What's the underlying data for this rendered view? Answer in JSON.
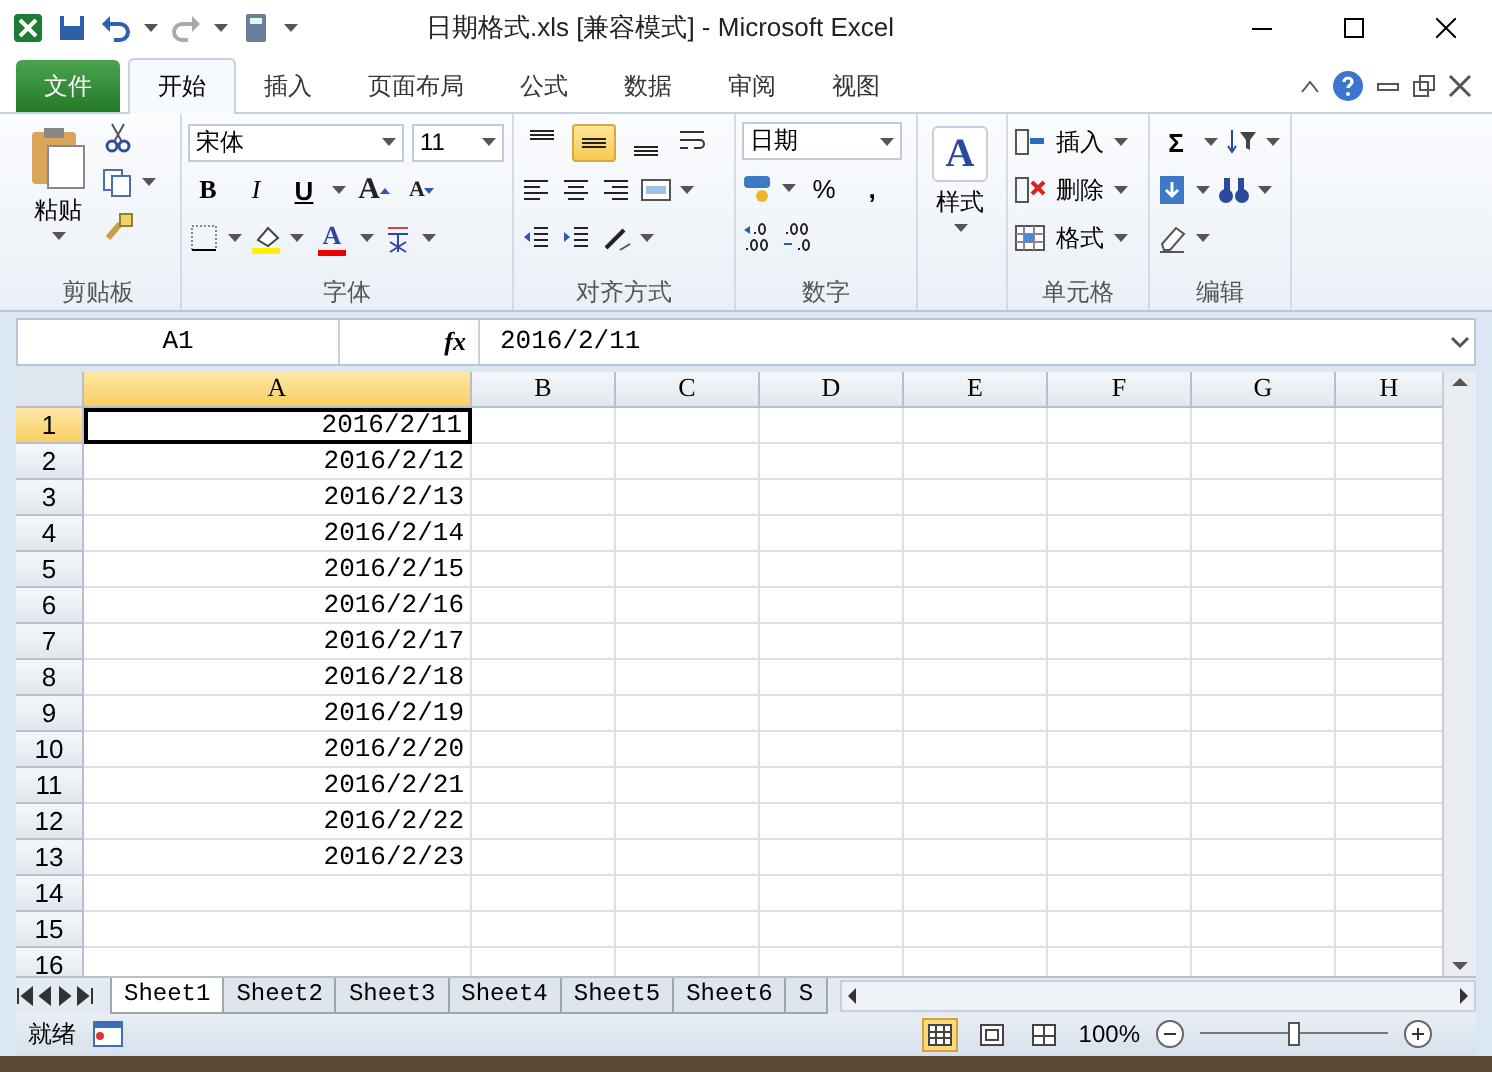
{
  "window": {
    "title": "日期格式.xls  [兼容模式]  -  Microsoft Excel"
  },
  "tabs": [
    {
      "label": "文件",
      "kind": "file",
      "selected": false
    },
    {
      "label": "开始",
      "kind": "tab",
      "selected": true
    },
    {
      "label": "插入",
      "kind": "tab",
      "selected": false
    },
    {
      "label": "页面布局",
      "kind": "tab",
      "selected": false
    },
    {
      "label": "公式",
      "kind": "tab",
      "selected": false
    },
    {
      "label": "数据",
      "kind": "tab",
      "selected": false
    },
    {
      "label": "审阅",
      "kind": "tab",
      "selected": false
    },
    {
      "label": "视图",
      "kind": "tab",
      "selected": false
    }
  ],
  "ribbon": {
    "clipboard": {
      "label": "剪贴板",
      "paste": "粘贴"
    },
    "font": {
      "label": "字体",
      "font_name": "宋体",
      "font_size": "11",
      "bold": "B",
      "italic": "I",
      "underline": "U",
      "grow": "A",
      "shrink": "A",
      "font_color": "A"
    },
    "alignment": {
      "label": "对齐方式",
      "vertical": [
        {
          "kind": "top",
          "selected": false
        },
        {
          "kind": "middle",
          "selected": true
        },
        {
          "kind": "bottom",
          "selected": false
        }
      ]
    },
    "number": {
      "label": "数字",
      "format": "日期",
      "percent": "%",
      "comma": ","
    },
    "styles": {
      "button": "样式",
      "icon_letter": "A"
    },
    "cells": {
      "label": "单元格",
      "items": [
        {
          "kind": "insert",
          "label": "插入"
        },
        {
          "kind": "delete",
          "label": "删除"
        },
        {
          "kind": "format",
          "label": "格式"
        }
      ]
    },
    "editing": {
      "label": "编辑",
      "sum": "Σ"
    }
  },
  "formula_bar": {
    "name_box": "A1",
    "function_label": "fx",
    "value": "2016/2/11"
  },
  "sheet": {
    "columns": [
      {
        "label": "A",
        "selected": true
      },
      {
        "label": "B",
        "selected": false
      },
      {
        "label": "C",
        "selected": false
      },
      {
        "label": "D",
        "selected": false
      },
      {
        "label": "E",
        "selected": false
      },
      {
        "label": "F",
        "selected": false
      },
      {
        "label": "G",
        "selected": false
      },
      {
        "label": "H",
        "selected": false
      }
    ],
    "rows": [
      {
        "number": "1",
        "value": "2016/2/11",
        "selected": true
      },
      {
        "number": "2",
        "value": "2016/2/12",
        "selected": false
      },
      {
        "number": "3",
        "value": "2016/2/13",
        "selected": false
      },
      {
        "number": "4",
        "value": "2016/2/14",
        "selected": false
      },
      {
        "number": "5",
        "value": "2016/2/15",
        "selected": false
      },
      {
        "number": "6",
        "value": "2016/2/16",
        "selected": false
      },
      {
        "number": "7",
        "value": "2016/2/17",
        "selected": false
      },
      {
        "number": "8",
        "value": "2016/2/18",
        "selected": false
      },
      {
        "number": "9",
        "value": "2016/2/19",
        "selected": false
      },
      {
        "number": "10",
        "value": "2016/2/20",
        "selected": false
      },
      {
        "number": "11",
        "value": "2016/2/21",
        "selected": false
      },
      {
        "number": "12",
        "value": "2016/2/22",
        "selected": false
      },
      {
        "number": "13",
        "value": "2016/2/23",
        "selected": false
      },
      {
        "number": "14",
        "selected": false
      },
      {
        "number": "15",
        "selected": false
      },
      {
        "number": "16",
        "selected": false
      }
    ]
  },
  "sheet_tabs": [
    {
      "label": "Sheet1",
      "selected": true
    },
    {
      "label": "Sheet2",
      "selected": false
    },
    {
      "label": "Sheet3",
      "selected": false
    },
    {
      "label": "Sheet4",
      "selected": false
    },
    {
      "label": "Sheet5",
      "selected": false
    },
    {
      "label": "Sheet6",
      "selected": false
    },
    {
      "label": "S",
      "selected": false
    }
  ],
  "status_bar": {
    "status": "就绪",
    "views": [
      {
        "kind": "normal",
        "selected": true
      },
      {
        "kind": "layout",
        "selected": false
      },
      {
        "kind": "pagebreak",
        "selected": false
      }
    ],
    "zoom": "100%",
    "zoom_slider": {
      "level": 0.5
    }
  }
}
